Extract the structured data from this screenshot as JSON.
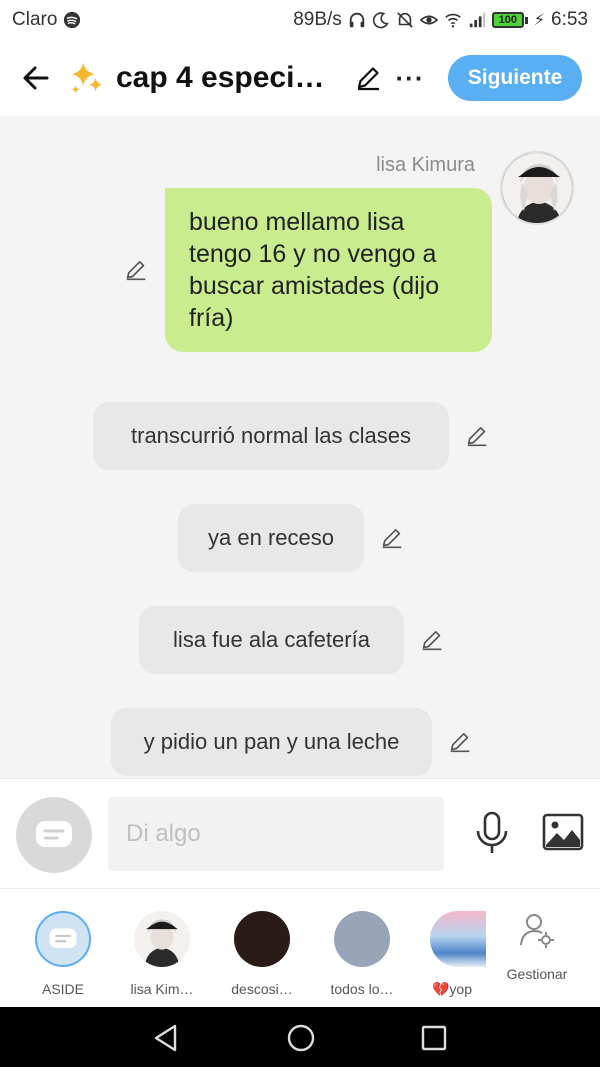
{
  "status_bar": {
    "carrier": "Claro",
    "speed": "89B/s",
    "battery": "100",
    "time": "6:53"
  },
  "header": {
    "title": "cap 4 especi…",
    "next_label": "Siguiente",
    "more_label": "···"
  },
  "chat": {
    "sender_name": "lisa Kimura",
    "message": "bueno mellamo lisa tengo 16 y no vengo a buscar amistades (dijo fría)",
    "narrations": [
      "transcurrió normal las clases",
      "ya en receso",
      "lisa fue ala cafetería",
      "y pidio un pan y una leche"
    ]
  },
  "input": {
    "placeholder": "Di algo"
  },
  "characters": [
    {
      "label": "ASIDE"
    },
    {
      "label": "lisa Kim…"
    },
    {
      "label": "descosi…"
    },
    {
      "label": "todos lo…"
    },
    {
      "label": "💔yop"
    }
  ],
  "manage_label": "Gestionar",
  "colors": {
    "accent": "#5aaef2",
    "user_bubble": "#c9ec8f",
    "narration_bubble": "#e8e8e8",
    "background": "#f4f4f4"
  }
}
